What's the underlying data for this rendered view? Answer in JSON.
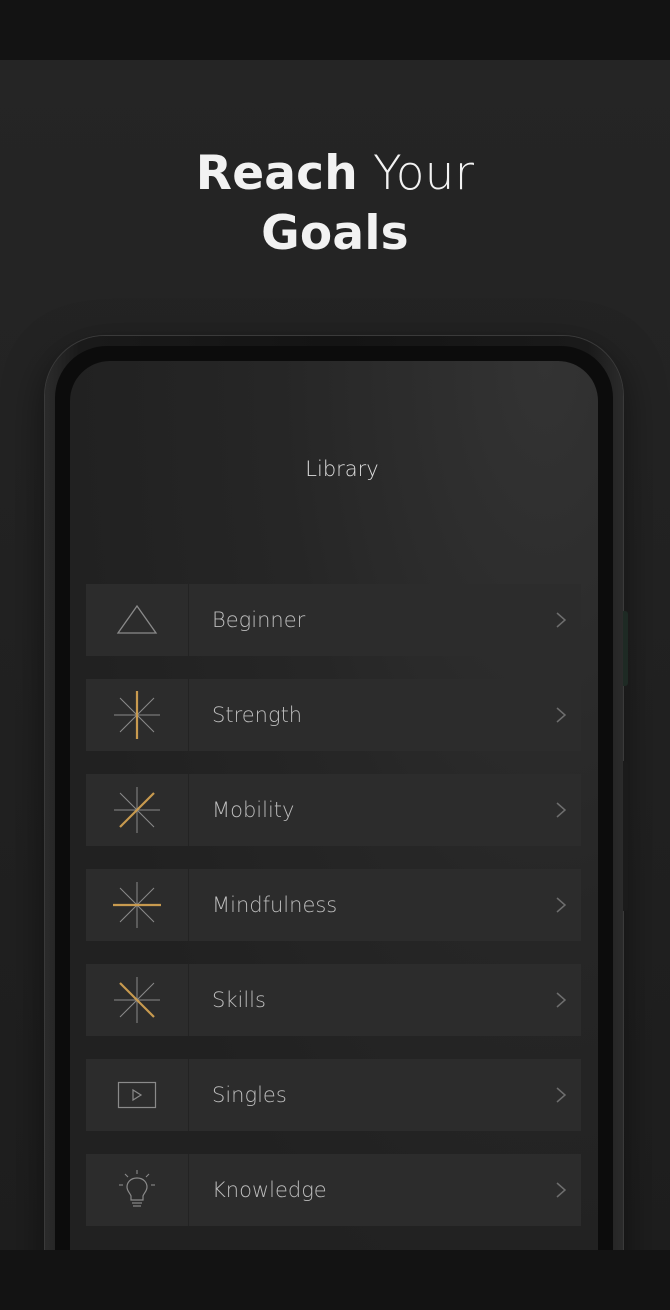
{
  "headline": {
    "line1_bold": "Reach",
    "line1_light": " Your",
    "line2_bold": "Goals"
  },
  "screen": {
    "title": "Library"
  },
  "colors": {
    "accent": "#c89a4f",
    "icon_gray": "#8a8a8a",
    "background": "#232323",
    "row": "#2c2c2c"
  },
  "library": {
    "items": [
      {
        "label": "Beginner",
        "icon": "triangle-icon"
      },
      {
        "label": "Strength",
        "icon": "starburst-vertical-accent-icon"
      },
      {
        "label": "Mobility",
        "icon": "starburst-diagonal-accent-icon"
      },
      {
        "label": "Mindfulness",
        "icon": "starburst-horizontal-accent-icon"
      },
      {
        "label": "Skills",
        "icon": "starburst-diagonal-down-accent-icon"
      },
      {
        "label": "Singles",
        "icon": "play-box-icon"
      },
      {
        "label": "Knowledge",
        "icon": "lightbulb-icon"
      }
    ]
  }
}
